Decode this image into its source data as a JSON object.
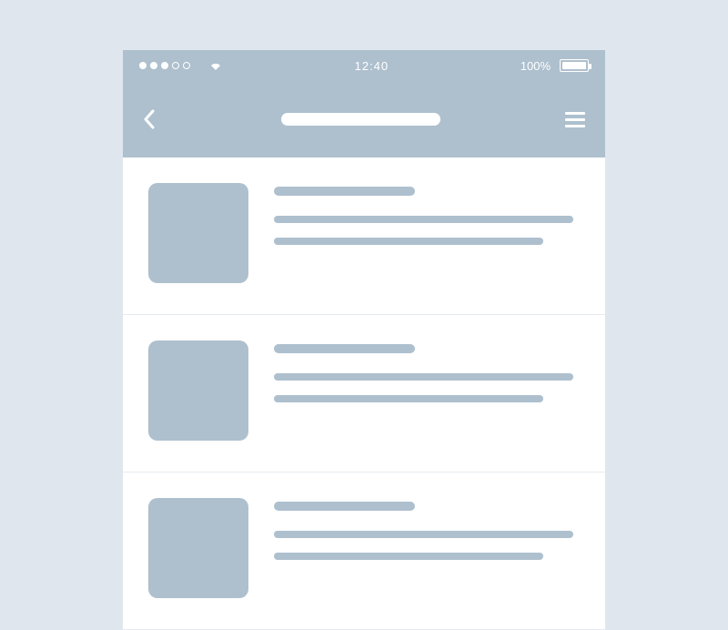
{
  "status_bar": {
    "signal_dots_filled": 3,
    "signal_dots_total": 5,
    "time": "12:40",
    "battery_percent": "100%"
  },
  "nav": {
    "title_placeholder": "",
    "back_label": "Back",
    "menu_label": "Menu"
  },
  "list": {
    "items": [
      {
        "title_placeholder": "",
        "line1_placeholder": "",
        "line2_placeholder": ""
      },
      {
        "title_placeholder": "",
        "line1_placeholder": "",
        "line2_placeholder": ""
      },
      {
        "title_placeholder": "",
        "line1_placeholder": "",
        "line2_placeholder": ""
      }
    ]
  }
}
